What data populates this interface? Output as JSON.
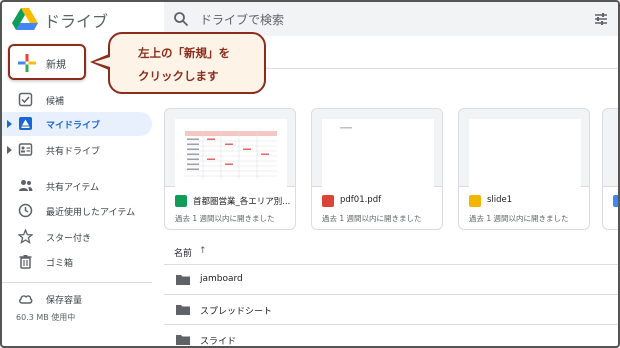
{
  "header": {
    "app_title": "ドライブ",
    "search_placeholder": "ドライブで検索"
  },
  "sidebar": {
    "new_label": "新規",
    "items": [
      {
        "label": "候補",
        "icon": "check-square-icon"
      },
      {
        "label": "マイドライブ",
        "icon": "my-drive-icon",
        "active": true
      },
      {
        "label": "共有ドライブ",
        "icon": "shared-drive-icon"
      },
      {
        "label": "共有アイテム",
        "icon": "people-icon"
      },
      {
        "label": "最近使用したアイテム",
        "icon": "clock-icon"
      },
      {
        "label": "スター付き",
        "icon": "star-icon"
      },
      {
        "label": "ゴミ箱",
        "icon": "trash-icon"
      },
      {
        "label": "保存容量",
        "icon": "cloud-icon"
      }
    ],
    "storage_used": "60.3 MB 使用中"
  },
  "callout": {
    "line1": "左上の「新規」を",
    "line2": "クリックします"
  },
  "quick_access": [
    {
      "name": "首都圏営業_各エリア別...",
      "sub": "過去 1 週間以内に開きました",
      "type": "sheets",
      "color": "#0f9d58"
    },
    {
      "name": "pdf01.pdf",
      "sub": "過去 1 週間以内に開きました",
      "type": "pdf",
      "color": "#db4437"
    },
    {
      "name": "slide1",
      "sub": "過去 1 週間以内に開きました",
      "type": "slides",
      "color": "#f4b400"
    }
  ],
  "list": {
    "column_name": "名前",
    "sort_arrow": "↑",
    "rows": [
      {
        "name": "jamboard"
      },
      {
        "name": "スプレッドシート"
      },
      {
        "name": "スライド"
      }
    ]
  },
  "colors": {
    "accent": "#1967d2",
    "callout_border": "#8b2c1c",
    "callout_fill": "#fdf3e6"
  }
}
